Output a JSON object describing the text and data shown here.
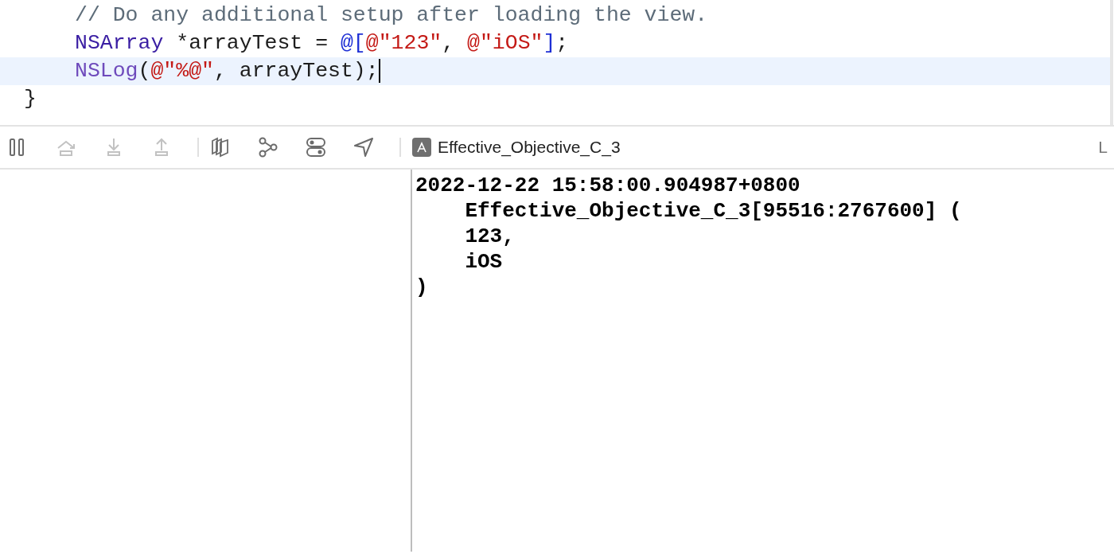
{
  "editor": {
    "lines": [
      {
        "current": false,
        "indented": true,
        "tokens": [
          {
            "kind": "comment",
            "text": "// Do any additional setup after loading the view."
          }
        ]
      },
      {
        "current": false,
        "indented": true,
        "tokens": [
          {
            "kind": "type",
            "text": "NSArray"
          },
          {
            "kind": "plain",
            "text": " *arrayTest = "
          },
          {
            "kind": "literal",
            "text": "@["
          },
          {
            "kind": "string",
            "text": "@\"123\""
          },
          {
            "kind": "plain",
            "text": ", "
          },
          {
            "kind": "string",
            "text": "@\"iOS\""
          },
          {
            "kind": "literal",
            "text": "]"
          },
          {
            "kind": "plain",
            "text": ";"
          }
        ]
      },
      {
        "current": true,
        "indented": true,
        "tokens": [
          {
            "kind": "function",
            "text": "NSLog"
          },
          {
            "kind": "plain",
            "text": "("
          },
          {
            "kind": "string",
            "text": "@\"%@\""
          },
          {
            "kind": "plain",
            "text": ", arrayTest);"
          }
        ]
      },
      {
        "current": false,
        "indented": false,
        "tokens": [
          {
            "kind": "plain",
            "text": "}"
          }
        ]
      }
    ]
  },
  "debug_bar": {
    "groups": [
      {
        "buttons": [
          {
            "kind": "pause",
            "disabled": false
          },
          {
            "kind": "step-over",
            "disabled": true
          },
          {
            "kind": "step-into",
            "disabled": true
          },
          {
            "kind": "step-out",
            "disabled": true
          }
        ]
      },
      {
        "buttons": [
          {
            "kind": "view-hierarchy",
            "disabled": false
          },
          {
            "kind": "memory-graph",
            "disabled": false
          },
          {
            "kind": "environment",
            "disabled": false
          },
          {
            "kind": "location",
            "disabled": false
          }
        ]
      }
    ],
    "target": "Effective_Objective_C_3",
    "right_label": "L"
  },
  "console": {
    "lines": [
      "2022-12-22 15:58:00.904987+0800",
      "    Effective_Objective_C_3[95516:2767600] (",
      "    123,",
      "    iOS",
      ")"
    ]
  }
}
